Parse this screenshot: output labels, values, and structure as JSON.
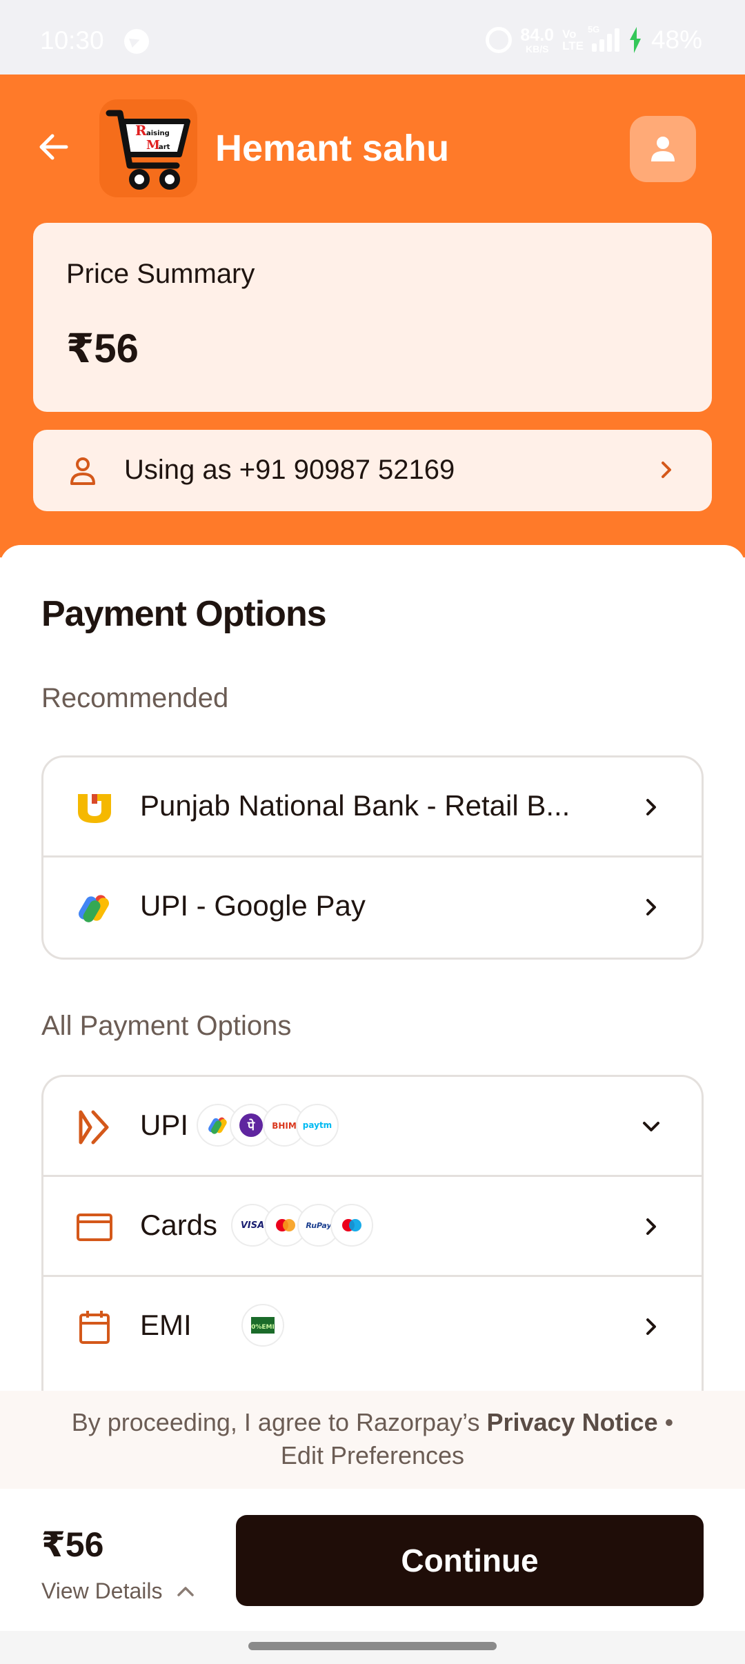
{
  "status_bar": {
    "time": "10:30",
    "speed_value": "84.0",
    "speed_unit": "KB/S",
    "volte_top": "Vo",
    "volte_bottom": "LTE",
    "network_tag": "5G",
    "battery": "48%"
  },
  "header": {
    "merchant_name": "Hemant sahu",
    "logo_text": "Raising Mart"
  },
  "price_summary": {
    "title": "Price Summary",
    "amount": "₹56"
  },
  "user": {
    "using_as": "Using as +91 90987 52169"
  },
  "payment": {
    "title": "Payment Options",
    "recommended_label": "Recommended",
    "recommended": [
      {
        "label": "Punjab National Bank - Retail B...",
        "icon": "pnb-bank-icon"
      },
      {
        "label": "UPI - Google Pay",
        "icon": "google-pay-icon"
      }
    ],
    "all_label": "All Payment Options",
    "all_options": [
      {
        "label": "UPI",
        "icon": "upi-icon",
        "badges": [
          "GPay",
          "PhonePe",
          "BHIM",
          "paytm"
        ]
      },
      {
        "label": "Cards",
        "icon": "card-icon",
        "badges": [
          "VISA",
          "Mastercard",
          "RuPay",
          "Maestro"
        ]
      },
      {
        "label": "EMI",
        "icon": "calendar-icon",
        "badges": [
          "0% EMI"
        ]
      }
    ]
  },
  "consent": {
    "prefix": "By proceeding, I agree to Razorpay’s",
    "privacy_link": "Privacy Notice",
    "separator": "•",
    "edit_link": "Edit Preferences"
  },
  "footer": {
    "total": "₹56",
    "view_details": "View Details",
    "continue_label": "Continue"
  },
  "colors": {
    "brand_orange": "#ff7a29",
    "card_bg": "#fff0e8",
    "button_dark": "#1f0d08",
    "accent_icon": "#d4581a"
  }
}
